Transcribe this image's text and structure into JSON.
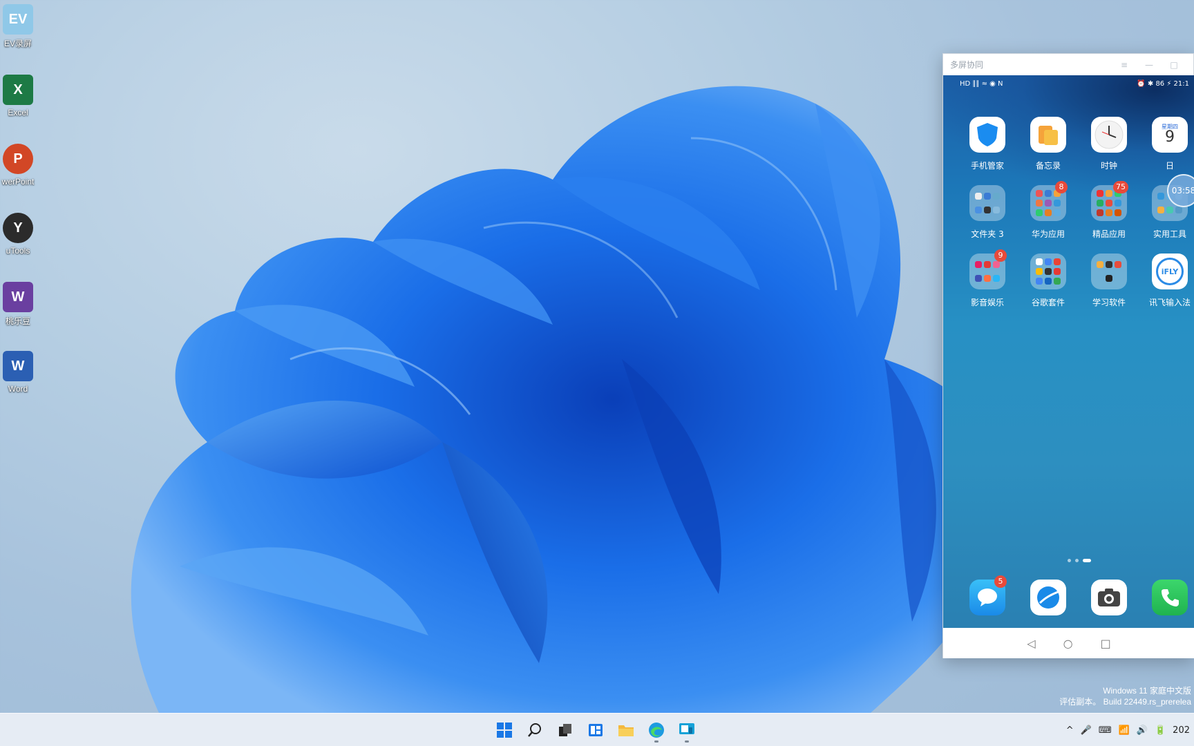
{
  "desktop": {
    "icons": [
      {
        "label": "EV录屏",
        "glyph": "EV",
        "color": "#8fc8e8"
      },
      {
        "label": "Excel",
        "glyph": "X",
        "color": "#1d7a45"
      },
      {
        "label": "werPoint",
        "glyph": "P",
        "color": "#d24726"
      },
      {
        "label": "uTools",
        "glyph": "Y",
        "color": "#2b2b2b"
      },
      {
        "label": "桃乐豆",
        "glyph": "W",
        "color": "#6a3fa0"
      },
      {
        "label": "Word",
        "glyph": "W",
        "color": "#2b5fb3"
      }
    ]
  },
  "phone_window": {
    "title": "多屏协同",
    "controls": {
      "menu": "≡",
      "minimize": "—",
      "maximize": "□"
    },
    "status": {
      "left": "HD ∥∥ ≈ ◉ N",
      "right": "⏰ ✱ 86 ⚡ 21:1"
    },
    "floating_clock": "03:58",
    "apps": [
      {
        "name": "手机管家",
        "badge": ""
      },
      {
        "name": "备忘录",
        "badge": ""
      },
      {
        "name": "时钟",
        "badge": ""
      },
      {
        "name": "日",
        "badge": "",
        "cal_day": "星期四",
        "cal_date": "9"
      },
      {
        "name": "文件夹 3",
        "badge": ""
      },
      {
        "name": "华为应用",
        "badge": "8"
      },
      {
        "name": "精品应用",
        "badge": "75"
      },
      {
        "name": "实用工具",
        "badge": ""
      },
      {
        "name": "影音娱乐",
        "badge": "9"
      },
      {
        "name": "谷歌套件",
        "badge": ""
      },
      {
        "name": "学习软件",
        "badge": ""
      },
      {
        "name": "讯飞输入法",
        "badge": "",
        "logo": "iFLY"
      }
    ],
    "dock": [
      {
        "name": "messages",
        "badge": "5"
      },
      {
        "name": "browser",
        "badge": ""
      },
      {
        "name": "camera",
        "badge": ""
      },
      {
        "name": "phone",
        "badge": ""
      }
    ],
    "nav": {
      "back": "◁",
      "home": "○",
      "recent": "□"
    }
  },
  "watermark": {
    "line1": "Windows 11 家庭中文版",
    "line2": "评估副本。 Build 22449.rs_prerelea"
  },
  "taskbar": {
    "tray_items": [
      "^",
      "🎤",
      "⌨",
      "📶",
      "🔊",
      "🔋",
      "202"
    ]
  },
  "colors": {
    "accent": "#0a5fd6",
    "badge": "#e84a3a"
  }
}
